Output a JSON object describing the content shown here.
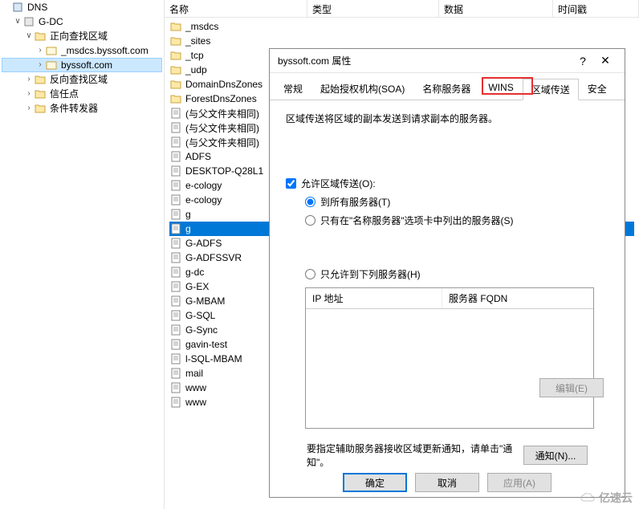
{
  "tree": {
    "root": "DNS",
    "node1": "G-DC",
    "forward": "正向查找区域",
    "zone_msdcs": "_msdcs.byssoft.com",
    "zone_selected": "byssoft.com",
    "reverse": "反向查找区域",
    "trust": "信任点",
    "cond": "条件转发器"
  },
  "headers": {
    "name": "名称",
    "type": "类型",
    "data": "数据",
    "ts": "时间戳"
  },
  "list": [
    "_msdcs",
    "_sites",
    "_tcp",
    "_udp",
    "DomainDnsZones",
    "ForestDnsZones",
    "(与父文件夹相同)",
    "(与父文件夹相同)",
    "(与父文件夹相同)",
    "ADFS",
    "DESKTOP-Q28L1",
    "e-cology",
    "e-cology",
    "g",
    "g",
    "G-ADFS",
    "G-ADFSSVR",
    "g-dc",
    "G-EX",
    "G-MBAM",
    "G-SQL",
    "G-Sync",
    "gavin-test",
    "l-SQL-MBAM",
    "mail",
    "www",
    "www"
  ],
  "list_selected_index": 14,
  "dialog": {
    "title": "byssoft.com 属性",
    "tabs": [
      "常规",
      "起始授权机构(SOA)",
      "名称服务器",
      "WINS",
      "区域传送",
      "安全"
    ],
    "active_tab": 4,
    "desc": "区域传送将区域的副本发送到请求副本的服务器。",
    "checkbox": "允许区域传送(O):",
    "radio_all": "到所有服务器(T)",
    "radio_ns": "只有在\"名称服务器\"选项卡中列出的服务器(S)",
    "radio_only": "只允许到下列服务器(H)",
    "ip_header1": "IP 地址",
    "ip_header2": "服务器 FQDN",
    "edit_btn": "编辑(E)",
    "notify_text": "要指定辅助服务器接收区域更新通知，请单击\"通知\"。",
    "notify_btn": "通知(N)...",
    "ok": "确定",
    "cancel": "取消",
    "apply": "应用(A)"
  },
  "watermark": "亿速云"
}
